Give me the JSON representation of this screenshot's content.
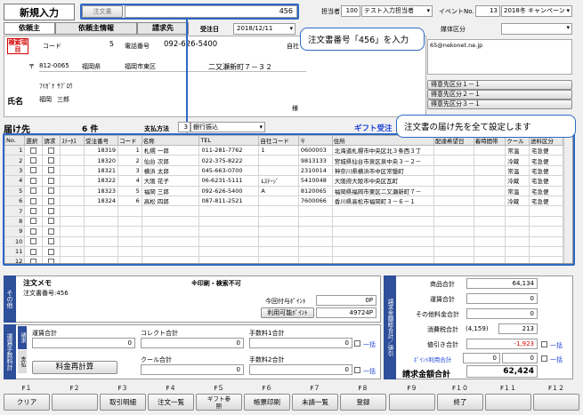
{
  "header": {
    "title": "新規入力",
    "order_no_label": "注文書",
    "order_no": "456",
    "staff_label": "担当者",
    "staff_code": "100",
    "staff_name": "テスト入力担当者",
    "event_label": "イベントNo.",
    "event_no": "13",
    "event_name": "2018冬 キャンペーン",
    "date_label": "受注日",
    "date": "2018/12/11",
    "media_label": "媒体区分"
  },
  "tabs": {
    "requester": "依頼主",
    "requester_info": "依頼主情報",
    "billing": "請求先"
  },
  "customer": {
    "search_label": "検索項目",
    "code_label": "コード",
    "code": "5",
    "phone_label": "電話番号",
    "phone": "092-626-5400",
    "self_code_label": "自社",
    "zip_mark": "〒",
    "zip": "812-0065",
    "pref": "福岡県",
    "city": "福岡市東区",
    "addr": "二又瀬新町７－３２",
    "kana_label": "ﾌﾘｶﾞﾅ",
    "kana": "ｻﾌﾞﾛｳ",
    "name_label": "氏名",
    "name_last": "福岡",
    "name_first": "三郎",
    "honor": "様",
    "email": "65@nekonet.ne.jp",
    "cust_cat1": "得意先区分１－１",
    "cust_cat2": "得意先区分２－１",
    "cust_cat3": "得意先区分３－１"
  },
  "callouts": {
    "c1": "注文書番号「456」を入力",
    "c2": "注文書の届け先を全て設定します"
  },
  "dest": {
    "label": "届け先",
    "count": "6 件",
    "pay_label": "支払方法",
    "pay_code": "3",
    "pay_name": "銀行振込",
    "gift_label": "ギフト受注"
  },
  "grid": {
    "columns": [
      "No.",
      "選択",
      "請求",
      "ｽﾃｰﾀｽ",
      "受注番号",
      "コード",
      "名称",
      "TEL",
      "自社コード",
      "〒",
      "住所",
      "配達希望日",
      "着時間帯",
      "クール",
      "送料区分"
    ],
    "rows": [
      {
        "no": "1",
        "order": "18319",
        "code": "1",
        "name": "札幌 一郎",
        "tel": "011-281-7762",
        "self": "1",
        "zip": "0600003",
        "addr": "北海道札幌市中央区北３条西３丁",
        "cool": "常温",
        "ship": "宅急便"
      },
      {
        "no": "2",
        "order": "18320",
        "code": "2",
        "name": "仙台 次郎",
        "tel": "022-375-8222",
        "self": "",
        "zip": "9813133",
        "addr": "宮城県仙台市泉区泉中央３－２－",
        "cool": "冷蔵",
        "ship": "宅急便"
      },
      {
        "no": "3",
        "order": "18321",
        "code": "3",
        "name": "横浜 太郎",
        "tel": "045-663-0700",
        "self": "",
        "zip": "2310014",
        "addr": "神奈川県横浜市中区常盤町",
        "cool": "常温",
        "ship": "宅急便"
      },
      {
        "no": "4",
        "order": "18322",
        "code": "4",
        "name": "大阪 花子",
        "tel": "06-6231-5111",
        "self": "Lｽﾃｰｼﾞ",
        "zip": "5410048",
        "addr": "大阪府大阪市中央区瓦町",
        "cool": "冷蔵",
        "ship": "宅急便"
      },
      {
        "no": "5",
        "order": "18323",
        "code": "5",
        "name": "福岡 三郎",
        "tel": "092-626-5400",
        "self": "A",
        "zip": "8120065",
        "addr": "福岡県福岡市東区二又瀬新町７－",
        "cool": "常温",
        "ship": "宅急便"
      },
      {
        "no": "6",
        "order": "18324",
        "code": "6",
        "name": "高松 四郎",
        "tel": "087-811-2521",
        "self": "",
        "zip": "7600066",
        "addr": "香川県高松市福岡町３－６－１",
        "cool": "冷蔵",
        "ship": "宅急便"
      },
      {
        "no": "7"
      },
      {
        "no": "8"
      },
      {
        "no": "9"
      },
      {
        "no": "10"
      },
      {
        "no": "11"
      },
      {
        "no": "12"
      }
    ]
  },
  "memo": {
    "side": "その他",
    "title": "注文メモ",
    "print_note": "※印刷・検索不可",
    "content": "注文書番号:456",
    "points_label": "今回付与ﾎﾟｲﾝﾄ",
    "points": "0P",
    "usable_btn": "利用可能ﾎﾟｲﾝﾄ",
    "usable": "49724P"
  },
  "fees": {
    "side": "運賃手数料計",
    "tab_req": "請求",
    "tab_pay": "支払",
    "shipping_label": "運賃合計",
    "collect_label": "コレクト合計",
    "fee1_label": "手数料1合計",
    "cool_label": "クール合計",
    "fee2_label": "手数料2合計",
    "shipping": "0",
    "collect": "0",
    "fee1": "0",
    "cool": "0",
    "fee2": "0",
    "bulk": "一括",
    "recalc": "料金再計算"
  },
  "totals": {
    "side": "請求金額総合計／値引",
    "goods_label": "商品合計",
    "goods": "64,134",
    "ship_label": "運賃合計",
    "ship": "0",
    "other_label": "その他料金合計",
    "other": "0",
    "tax_label": "消費税合計",
    "tax_base": "(4,159)",
    "tax": "213",
    "discount_label": "値引き合計",
    "discount": "-1,923",
    "point_label": "ﾎﾟｲﾝﾄ利用合計",
    "point": "0",
    "point2": "0",
    "bulk": "一括",
    "grand_label": "請求金額合計",
    "grand": "62,424"
  },
  "fkeys": [
    {
      "k": "F１",
      "b": "クリア"
    },
    {
      "k": "F２",
      "b": ""
    },
    {
      "k": "F３",
      "b": "取引明細"
    },
    {
      "k": "F４",
      "b": "注文一覧"
    },
    {
      "k": "F５",
      "b": "ギフト参照"
    },
    {
      "k": "F６",
      "b": "帳票印刷"
    },
    {
      "k": "F７",
      "b": "未請一覧"
    },
    {
      "k": "F８",
      "b": "登録"
    },
    {
      "k": "F９",
      "b": ""
    },
    {
      "k": "F１０",
      "b": "終了"
    },
    {
      "k": "F１１",
      "b": ""
    },
    {
      "k": "F１２",
      "b": ""
    }
  ],
  "colors": {
    "accent": "#2b69c4",
    "title_green": "#2e8a2e",
    "label_red": "#d40000"
  }
}
